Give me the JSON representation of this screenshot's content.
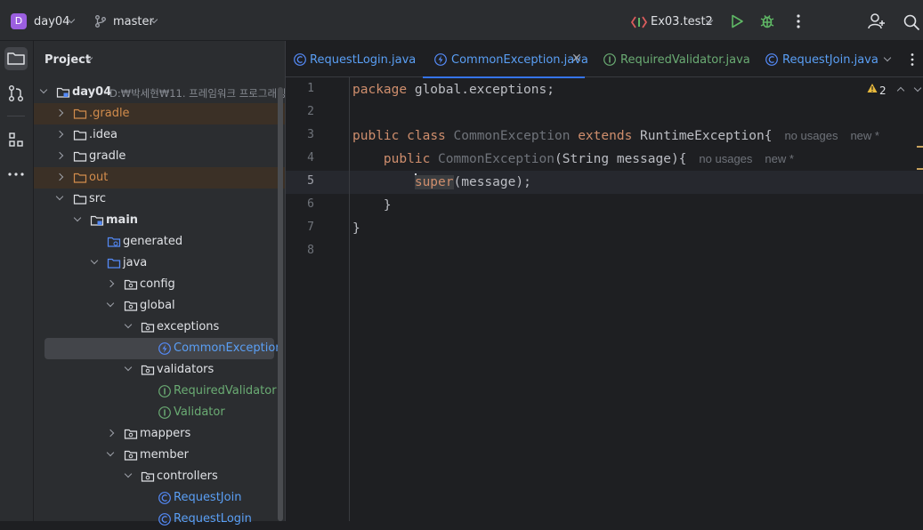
{
  "topbar": {
    "project_badge": "D",
    "project_name": "day04",
    "branch": "master",
    "run_config": "Ex03.test2"
  },
  "project_panel": {
    "title": "Project",
    "root": {
      "name": "day04",
      "path": "D:₩박세현₩11. 프레임워크 프로그래밍"
    },
    "items": [
      {
        "label": ".gradle"
      },
      {
        "label": ".idea"
      },
      {
        "label": "gradle"
      },
      {
        "label": "out"
      },
      {
        "label": "src"
      },
      {
        "label": "main"
      },
      {
        "label": "generated"
      },
      {
        "label": "java"
      },
      {
        "label": "config"
      },
      {
        "label": "global"
      },
      {
        "label": "exceptions"
      },
      {
        "label": "CommonException"
      },
      {
        "label": "validators"
      },
      {
        "label": "RequiredValidator"
      },
      {
        "label": "Validator"
      },
      {
        "label": "mappers"
      },
      {
        "label": "member"
      },
      {
        "label": "controllers"
      },
      {
        "label": "RequestJoin"
      },
      {
        "label": "RequestLogin"
      }
    ]
  },
  "editor": {
    "tabs": [
      {
        "label": "RequestLogin.java"
      },
      {
        "label": "CommonException.java"
      },
      {
        "label": "RequiredValidator.java"
      },
      {
        "label": "RequestJoin.java"
      }
    ],
    "warnings_count": "2",
    "line_numbers": [
      "1",
      "2",
      "3",
      "4",
      "5",
      "6",
      "7",
      "8"
    ],
    "code": {
      "l1_kw": "package",
      "l1_rest": " global.exceptions;",
      "l3_kw1": "public",
      "l3_kw2": "class",
      "l3_cls": "CommonException",
      "l3_kw3": "extends",
      "l3_rest": " RuntimeException{",
      "l4_kw": "public",
      "l4_cls": "CommonException",
      "l4_rest": "(String message){",
      "l5_kw": "super",
      "l5_rest": "(message);",
      "l6": "}",
      "l7": "}"
    },
    "hints": {
      "no_usages": "no usages",
      "new": "new *"
    }
  },
  "colors": {
    "accent": "#3574f0",
    "keyword": "#cf8e6d",
    "badge": "#9b5fe0",
    "excluded_folder": "#d28c4c",
    "vcs_new": "#6aab73"
  }
}
